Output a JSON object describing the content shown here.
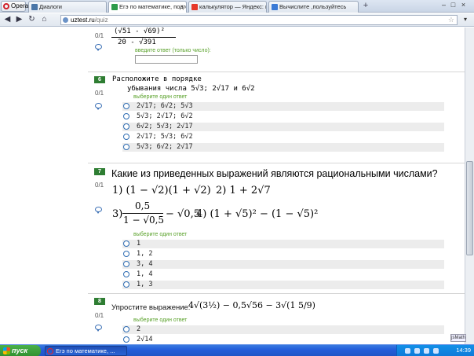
{
  "browser": {
    "opera_label": "Opera",
    "tabs": [
      {
        "title": "Диалоги",
        "fav_color": "#4a76a8",
        "active": false
      },
      {
        "title": "Егэ по математике, подгот",
        "fav_color": "#2e9b4a",
        "active": true
      },
      {
        "title": "калькулятор — Яндекс: на",
        "fav_color": "#e6382a",
        "active": false
      },
      {
        "title": "Вычислите ,пользуйтесь",
        "fav_color": "#3a7ad6",
        "active": false
      }
    ],
    "new_tab": "+",
    "url_host": "uztest.ru",
    "url_path": "/quiz",
    "dropdown": "▾"
  },
  "questions": {
    "q5": {
      "score": "0/1",
      "formula_top": "(√51 - √69)²",
      "formula_bottom": "20 - √391",
      "hint": "введите ответ (только число):",
      "input_value": ""
    },
    "q6": {
      "number": "6",
      "score": "0/1",
      "line1": "Расположите в порядке",
      "line2": "убывания числа  5√3;  2√17  и  6√2",
      "hint": "выберите один ответ",
      "options": [
        "2√17;  6√2;  5√3",
        "5√3;  2√17;  6√2",
        "6√2;  5√3;  2√17",
        "2√17;  5√3;  6√2",
        "5√3;  6√2;  2√17"
      ]
    },
    "q7": {
      "number": "7",
      "score": "0/1",
      "title": "Какие из приведенных выражений являются рациональными числами?",
      "expr1": "1) (1 − √2)(1 + √2)",
      "expr2": "2) 1 + 2√7",
      "expr3_label": "3)",
      "expr3_num": "0,5",
      "expr3_den": "1 − √0,5",
      "expr3_tail": "− √0,5",
      "expr4": "4) (1 + √5)² − (1 − √5)²",
      "hint": "выберите один ответ",
      "options": [
        "1",
        "1, 2",
        "3, 4",
        "1, 4",
        "1, 3"
      ]
    },
    "q8": {
      "number": "8",
      "score": "0/1",
      "title": "Упростите выражение:",
      "formula": "4√(3½) − 0,5√56 − 3√(1 5/9)",
      "hint": "выберите один ответ",
      "options": [
        "2",
        "2√14"
      ]
    }
  },
  "widget": {
    "label": "jsMath"
  },
  "taskbar": {
    "start_label": "пуск",
    "task_title": "Егэ по математике, ...",
    "clock": "14:39"
  }
}
